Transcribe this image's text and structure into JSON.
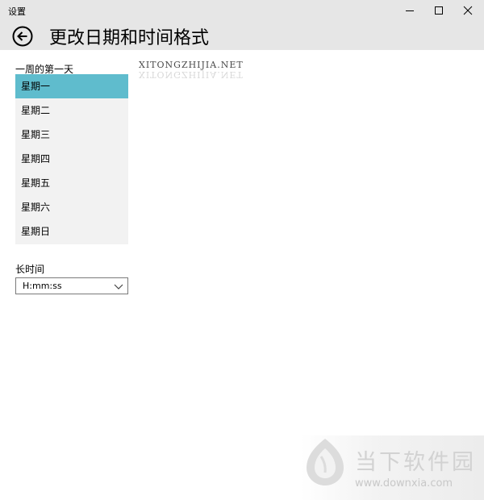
{
  "window": {
    "app_title": "设置"
  },
  "header": {
    "page_title": "更改日期和时间格式"
  },
  "first_day_of_week": {
    "label": "一周的第一天",
    "selected_index": 0,
    "options": [
      "星期一",
      "星期二",
      "星期三",
      "星期四",
      "星期五",
      "星期六",
      "星期日"
    ]
  },
  "long_time": {
    "label": "长时间",
    "value": "H:mm:ss"
  },
  "watermarks": {
    "top_text": "XITONGZHIJIA.NET",
    "brand": "当下软件园",
    "url": "www.downxia.com"
  },
  "colors": {
    "titlebar_bg": "#e6e6e6",
    "list_bg": "#f2f2f2",
    "selection": "#5fbccd"
  },
  "icons": {
    "back": "back-arrow-circle-icon",
    "minimize": "minimize-icon",
    "maximize": "maximize-icon",
    "close": "close-icon",
    "dropdown": "chevron-down-icon"
  }
}
